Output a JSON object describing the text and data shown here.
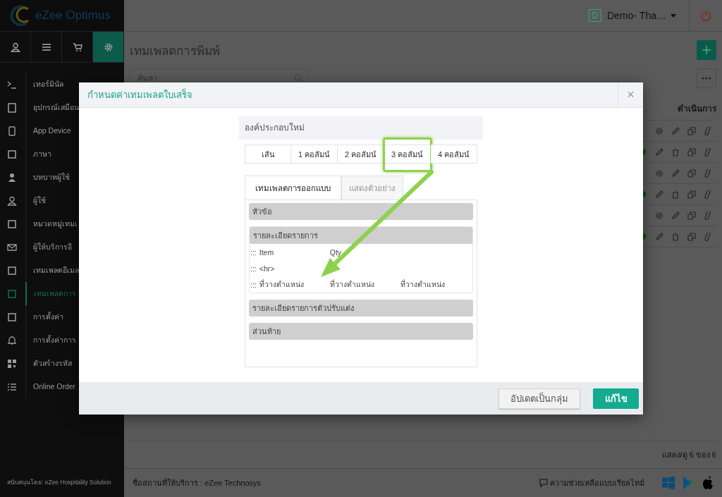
{
  "brand": {
    "name": "eZee Optimus"
  },
  "top_tabs": [
    {
      "selected": false
    },
    {
      "selected": false
    },
    {
      "selected": false
    },
    {
      "selected": true
    }
  ],
  "menu": [
    {
      "label": "เทอร์มินัล",
      "selected": false
    },
    {
      "label": "อุปกรณ์เสมือน",
      "selected": false
    },
    {
      "label": "App Device",
      "selected": false
    },
    {
      "label": "ภาษา",
      "selected": false
    },
    {
      "label": "บทบาทผู้ใช้",
      "selected": false
    },
    {
      "label": "ผู้ใช้",
      "selected": false
    },
    {
      "label": "หมวดหมู่เทมเ",
      "selected": false
    },
    {
      "label": "ผู้ให้บริการอี",
      "selected": false
    },
    {
      "label": "เทมเพลตอีเมล",
      "selected": false
    },
    {
      "label": "เทมเพลตการ",
      "selected": true
    },
    {
      "label": "การตั้งค่า",
      "selected": false
    },
    {
      "label": "การตั้งค่าการ",
      "selected": false
    },
    {
      "label": "ตัวสร้างรหัส",
      "selected": false
    },
    {
      "label": "Online Order",
      "selected": false
    }
  ],
  "sponsor": "สนับสนุนโดย: eZee Hospitality Solution",
  "header": {
    "badge": "D",
    "property": "Demo- Tha…"
  },
  "page": {
    "title": "เทมเพลตการพิมพ์",
    "search_placeholder": "ค้นหา",
    "actions_header": "ดำเนินการ",
    "rows": [
      {
        "kind": "builtin"
      },
      {
        "kind": "custom"
      },
      {
        "kind": "builtin"
      },
      {
        "kind": "custom"
      },
      {
        "kind": "builtin"
      },
      {
        "kind": "custom"
      }
    ],
    "pagination": "แสดง/ดู 6 ของ 6"
  },
  "footer": {
    "provider": "ชื่อสถานที่ให้บริการ : eZee Technosys",
    "help": "ความช่วยเหลือแบบเรียลไทม์"
  },
  "dialog": {
    "title": "กำหนดค่าเทมเพลตใบเสร็จ",
    "close": "×",
    "section": "องค์ประกอบใหม่",
    "column_buttons": [
      {
        "label": "เส้น",
        "highlighted": false
      },
      {
        "label": "1 คอลัมน์",
        "highlighted": false
      },
      {
        "label": "2 คอลัมน์",
        "highlighted": false
      },
      {
        "label": "3 คอลัมน์",
        "highlighted": true
      },
      {
        "label": "4 คอลัมน์",
        "highlighted": false
      }
    ],
    "tabs": [
      {
        "label": "เทมเพลตการออกแบบ",
        "selected": true
      },
      {
        "label": "แสดงตัวอย่าง",
        "selected": false
      }
    ],
    "blocks": [
      {
        "title": "หัวข้อ"
      },
      {
        "title": "รายละเอียดรายการ",
        "lines": [
          {
            "handle": ":::",
            "cells": [
              "Item",
              "Qty"
            ]
          },
          {
            "handle": ":::",
            "cells": [
              "<hr>"
            ]
          },
          {
            "handle": ":::",
            "cells": [
              "ที่วางตำแหน่ง",
              "ที่วางตำแหน่ง",
              "ที่วางตำแหน่ง"
            ]
          }
        ]
      },
      {
        "title": "รายละเอียดรายการตัวปรับแต่ง"
      },
      {
        "title": "ส่วนท้าย"
      }
    ],
    "buttons": [
      {
        "label": "อัปเดตเป็นกลุ่ม",
        "kind": "secondary"
      },
      {
        "label": "แก้ไข",
        "kind": "primary"
      }
    ]
  }
}
